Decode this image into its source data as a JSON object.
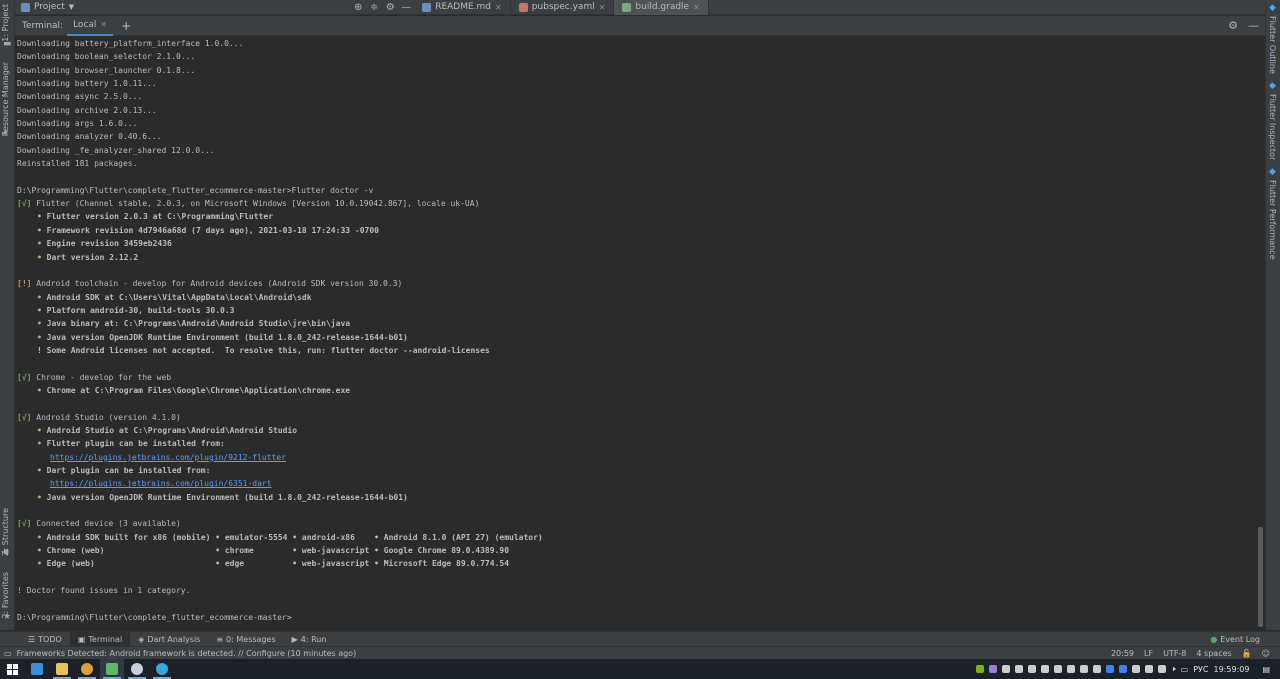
{
  "left_strip": {
    "project_tab": "1: Project",
    "resource_manager_tab": "Resource Manager",
    "structure_tab": "Z: Structure",
    "favorites_tab": "2: Favorites"
  },
  "right_strip": {
    "flutter_outline_tab": "Flutter Outline",
    "flutter_inspector_tab": "Flutter Inspector",
    "flutter_performance_tab": "Flutter Performance"
  },
  "topbar": {
    "project_label": "Project",
    "tabs": [
      {
        "label": "README.md",
        "color": "#6a8fbf"
      },
      {
        "label": "pubspec.yaml",
        "color": "#c07a6a"
      },
      {
        "label": "build.gradle",
        "color": "#7fa882"
      }
    ]
  },
  "terminal_header": {
    "title": "Terminal:",
    "tab_label": "Local",
    "add_label": "+"
  },
  "terminal": {
    "lines": [
      {
        "kind": "plain",
        "text": "Downloading battery_platform_interface 1.0.0..."
      },
      {
        "kind": "plain",
        "text": "Downloading boolean_selector 2.1.0..."
      },
      {
        "kind": "plain",
        "text": "Downloading browser_launcher 0.1.8..."
      },
      {
        "kind": "plain",
        "text": "Downloading battery 1.0.11..."
      },
      {
        "kind": "plain",
        "text": "Downloading async 2.5.0..."
      },
      {
        "kind": "plain",
        "text": "Downloading archive 2.0.13..."
      },
      {
        "kind": "plain",
        "text": "Downloading args 1.6.0..."
      },
      {
        "kind": "plain",
        "text": "Downloading analyzer 0.40.6..."
      },
      {
        "kind": "plain",
        "text": "Downloading _fe_analyzer_shared 12.0.0..."
      },
      {
        "kind": "plain",
        "text": "Reinstalled 181 packages."
      },
      {
        "kind": "blank",
        "text": ""
      },
      {
        "kind": "plain",
        "text": "D:\\Programming\\Flutter\\complete_flutter_ecommerce-master>Flutter doctor -v"
      },
      {
        "kind": "mark",
        "mark": "[√]",
        "text": " Flutter (Channel stable, 2.0.3, on Microsoft Windows [Version 10.0.19042.867], locale uk-UA)"
      },
      {
        "kind": "bullet",
        "text": "Flutter version 2.0.3 at C:\\Programming\\Flutter"
      },
      {
        "kind": "bullet",
        "text": "Framework revision 4d7946a68d (7 days ago), 2021-03-18 17:24:33 -0700"
      },
      {
        "kind": "bullet",
        "text": "Engine revision 3459eb2436"
      },
      {
        "kind": "bullet",
        "text": "Dart version 2.12.2"
      },
      {
        "kind": "blank",
        "text": ""
      },
      {
        "kind": "warnmark",
        "mark": "[!]",
        "text": " Android toolchain - develop for Android devices (Android SDK version 30.0.3)"
      },
      {
        "kind": "bullet",
        "text": "Android SDK at C:\\Users\\Vital\\AppData\\Local\\Android\\sdk"
      },
      {
        "kind": "bullet",
        "text": "Platform android-30, build-tools 30.0.3"
      },
      {
        "kind": "bullet",
        "text": "Java binary at: C:\\Programs\\Android\\Android Studio\\jre\\bin\\java"
      },
      {
        "kind": "bullet",
        "text": "Java version OpenJDK Runtime Environment (build 1.8.0_242-release-1644-b01)"
      },
      {
        "kind": "warn",
        "text": "Some Android licenses not accepted.  To resolve this, run: flutter doctor --android-licenses"
      },
      {
        "kind": "blank",
        "text": ""
      },
      {
        "kind": "mark",
        "mark": "[√]",
        "text": " Chrome - develop for the web"
      },
      {
        "kind": "bullet",
        "text": "Chrome at C:\\Program Files\\Google\\Chrome\\Application\\chrome.exe"
      },
      {
        "kind": "blank",
        "text": ""
      },
      {
        "kind": "mark",
        "mark": "[√]",
        "text": " Android Studio (version 4.1.0)"
      },
      {
        "kind": "bullet",
        "text": "Android Studio at C:\\Programs\\Android\\Android Studio"
      },
      {
        "kind": "bullet",
        "text": "Flutter plugin can be installed from:"
      },
      {
        "kind": "link",
        "text": "https://plugins.jetbrains.com/plugin/9212-flutter"
      },
      {
        "kind": "bullet",
        "text": "Dart plugin can be installed from:"
      },
      {
        "kind": "link",
        "text": "https://plugins.jetbrains.com/plugin/6351-dart"
      },
      {
        "kind": "bullet",
        "text": "Java version OpenJDK Runtime Environment (build 1.8.0_242-release-1644-b01)"
      },
      {
        "kind": "blank",
        "text": ""
      },
      {
        "kind": "mark",
        "mark": "[√]",
        "text": " Connected device (3 available)"
      },
      {
        "kind": "bullet",
        "text": "Android SDK built for x86 (mobile) • emulator-5554 • android-x86    • Android 8.1.0 (API 27) (emulator)"
      },
      {
        "kind": "bullet",
        "text": "Chrome (web)                       • chrome        • web-javascript • Google Chrome 89.0.4389.90"
      },
      {
        "kind": "bullet",
        "text": "Edge (web)                         • edge          • web-javascript • Microsoft Edge 89.0.774.54"
      },
      {
        "kind": "blank",
        "text": ""
      },
      {
        "kind": "plain",
        "text": "! Doctor found issues in 1 category."
      },
      {
        "kind": "blank",
        "text": ""
      },
      {
        "kind": "plain",
        "text": "D:\\Programming\\Flutter\\complete_flutter_ecommerce-master>"
      }
    ]
  },
  "toolwindows": {
    "todo": "TODO",
    "terminal": "Terminal",
    "dart_analysis": "Dart Analysis",
    "messages": "0: Messages",
    "run": "4: Run",
    "event_log": "Event Log"
  },
  "statusbar": {
    "message": "Frameworks Detected: Android framework is detected. // Configure (10 minutes ago)",
    "position": "20:59",
    "line_sep": "LF",
    "encoding": "UTF-8",
    "indent": "4 spaces"
  },
  "taskbar": {
    "language": "РУС",
    "time": "19:59:09"
  }
}
